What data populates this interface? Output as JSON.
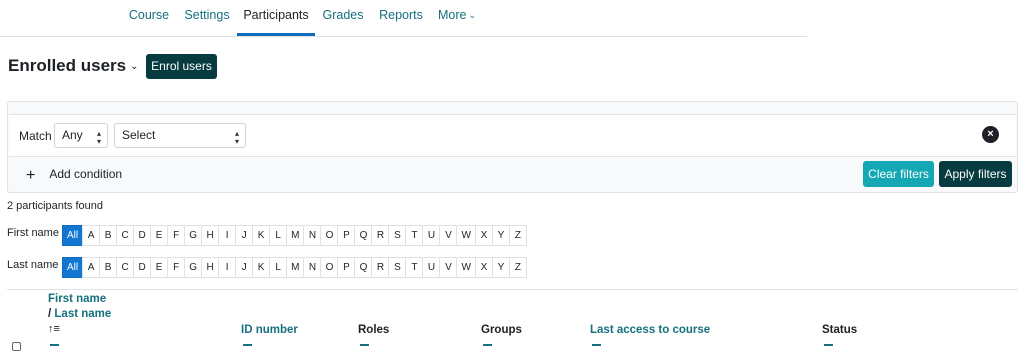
{
  "nav": {
    "tabs": [
      {
        "label": "Course"
      },
      {
        "label": "Settings"
      },
      {
        "label": "Participants"
      },
      {
        "label": "Grades"
      },
      {
        "label": "Reports"
      },
      {
        "label": "More"
      }
    ]
  },
  "header": {
    "title": "Enrolled users",
    "enrol_button": "Enrol users"
  },
  "filters": {
    "match_label": "Match",
    "match_value": "Any",
    "select_value": "Select",
    "remove_icon": "×",
    "add_condition": "Add condition",
    "add_icon": "+",
    "clear_button": "Clear filters",
    "apply_button": "Apply filters"
  },
  "participants": {
    "count_text": "2 participants found",
    "first_name_label": "First name",
    "last_name_label": "Last name",
    "letters": [
      "All",
      "A",
      "B",
      "C",
      "D",
      "E",
      "F",
      "G",
      "H",
      "I",
      "J",
      "K",
      "L",
      "M",
      "N",
      "O",
      "P",
      "Q",
      "R",
      "S",
      "T",
      "U",
      "V",
      "W",
      "X",
      "Y",
      "Z"
    ]
  },
  "table": {
    "col_first_name": "First name",
    "col_sep": "/",
    "col_last_name": "Last name",
    "sort_icon": "↑≡",
    "col_id": "ID number",
    "col_roles": "Roles",
    "col_groups": "Groups",
    "col_last_access": "Last access to course",
    "col_status": "Status"
  },
  "colors": {
    "accent_dark": "#063b40",
    "accent_teal": "#14a8b4",
    "link": "#16707f",
    "active_letter": "#1177d1"
  }
}
